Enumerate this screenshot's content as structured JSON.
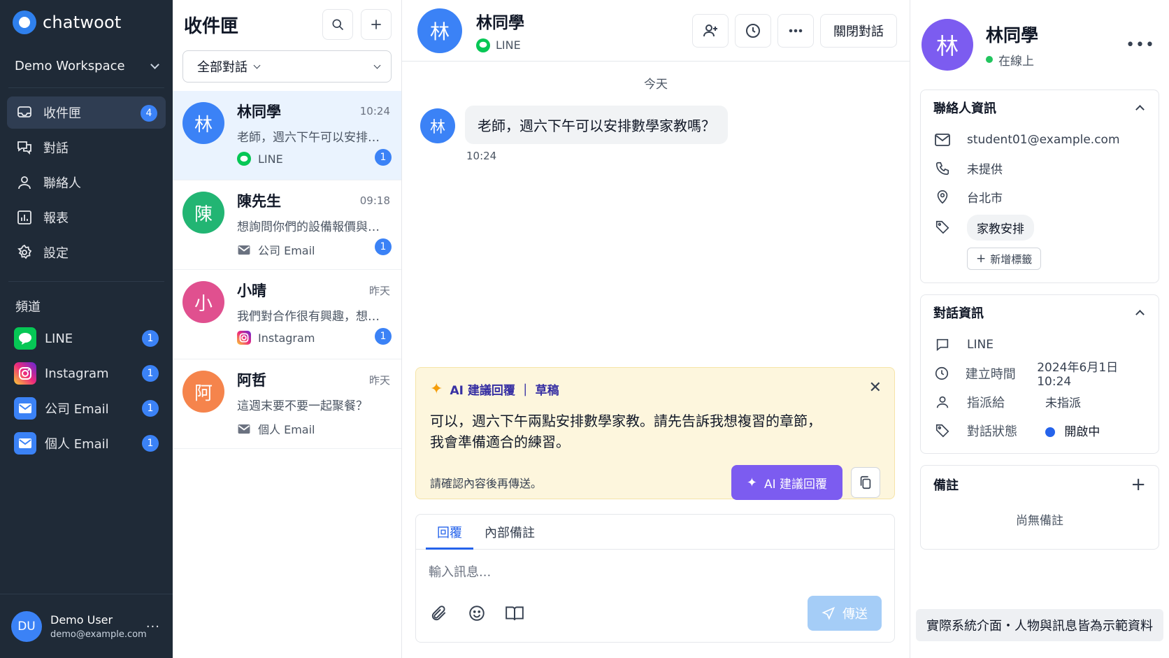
{
  "brand": {
    "name": "chatwoot"
  },
  "workspace": {
    "name": "Demo Workspace"
  },
  "nav": [
    {
      "label": "收件匣",
      "badge": "4"
    },
    {
      "label": "對話"
    },
    {
      "label": "聯絡人"
    },
    {
      "label": "報表"
    },
    {
      "label": "設定"
    }
  ],
  "channels": {
    "title": "頻道",
    "items": [
      {
        "label": "LINE",
        "badge": "1"
      },
      {
        "label": "Instagram",
        "badge": "1"
      },
      {
        "label": "公司 Email",
        "badge": "1"
      },
      {
        "label": "個人 Email",
        "badge": "1"
      }
    ]
  },
  "user": {
    "initials": "DU",
    "name": "Demo User",
    "email": "demo@example.com",
    "more": "···"
  },
  "inbox": {
    "title": "收件匣",
    "filter": "全部對話",
    "conversations": [
      {
        "initial": "林",
        "name": "林同學",
        "time": "10:24",
        "preview": "老師，週六下午可以安排數學家教嗎？",
        "channel": "LINE",
        "badge": "1",
        "color": "#3b82f6"
      },
      {
        "initial": "陳",
        "name": "陳先生",
        "time": "09:18",
        "preview": "想詢問你們的設備報價與交期",
        "channel": "公司 Email",
        "badge": "1",
        "color": "#22b573"
      },
      {
        "initial": "小",
        "name": "小晴",
        "time": "昨天",
        "preview": "我們對合作很有興趣，想進一步了解",
        "channel": "Instagram",
        "badge": "1",
        "color": "#e0508f"
      },
      {
        "initial": "阿",
        "name": "阿哲",
        "time": "昨天",
        "preview": "這週末要不要一起聚餐？",
        "channel": "個人 Email",
        "badge": "",
        "color": "#f5844c"
      }
    ]
  },
  "chat": {
    "initial": "林",
    "name": "林同學",
    "channel": "LINE",
    "close_label": "關閉對話",
    "day": "今天",
    "message": {
      "initial": "林",
      "text": "老師，週六下午可以安排數學家教嗎？",
      "time": "10:24"
    },
    "ai": {
      "title": "AI 建議回覆 ｜ 草稿",
      "line1": "可以，週六下午兩點安排數學家教。請先告訴我想複習的章節，",
      "line2": "我會準備適合的練習。",
      "note": "請確認內容後再傳送。",
      "button": "AI 建議回覆"
    },
    "composer": {
      "tab_reply": "回覆",
      "tab_note": "內部備註",
      "placeholder": "輸入訊息...",
      "send": "傳送"
    }
  },
  "contact": {
    "initial": "林",
    "name": "林同學",
    "status": "在線上",
    "info_title": "聯絡人資訊",
    "email": "student01@example.com",
    "phone": "未提供",
    "location": "台北市",
    "tag": "家教安排",
    "add_tag": "新增標籤",
    "conv_title": "對話資訊",
    "conv_channel": "LINE",
    "created_label": "建立時間",
    "created_value": "2024年6月1日 10:24",
    "assignee_label": "指派給",
    "assignee_value": "未指派",
    "state_label": "對話狀態",
    "state_value": "開啟中",
    "notes_title": "備註",
    "notes_empty": "尚無備註",
    "banner": "實際系統介面・人物與訊息皆為示範資料"
  },
  "colors": {
    "sidebar": "#1f2a37",
    "accent": "#3b82f6",
    "ai_card": "#fdf6dd",
    "ai_button": "#7c5cf0",
    "line": "#06c755"
  }
}
